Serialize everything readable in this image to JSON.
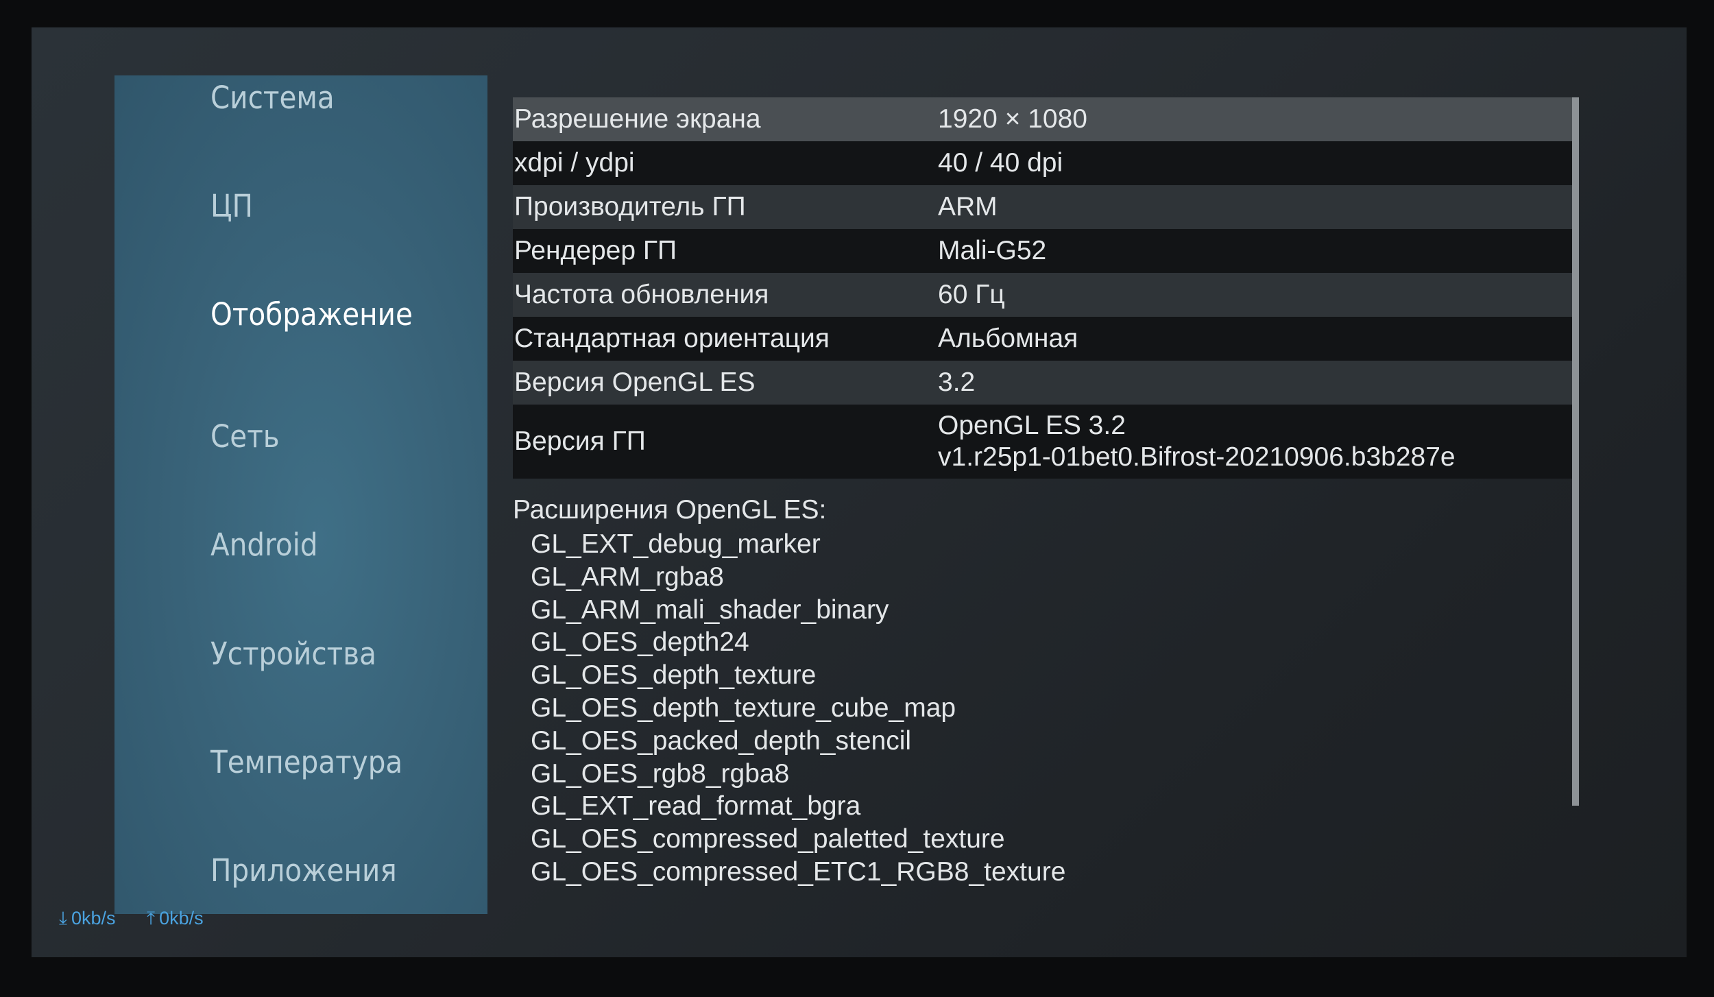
{
  "sidebar": {
    "items": [
      {
        "label": "Система"
      },
      {
        "label": "ЦП"
      },
      {
        "label": "Отображение"
      },
      {
        "label": "Сеть"
      },
      {
        "label": "Android"
      },
      {
        "label": "Устройства"
      },
      {
        "label": "Температура"
      },
      {
        "label": "Приложения"
      }
    ],
    "active_index": 2
  },
  "display_info": {
    "rows": [
      {
        "key": "Разрешение экрана",
        "value": "1920 × 1080"
      },
      {
        "key": "xdpi / ydpi",
        "value": "40 / 40 dpi"
      },
      {
        "key": "Производитель ГП",
        "value": "ARM"
      },
      {
        "key": "Рендерер ГП",
        "value": "Mali-G52"
      },
      {
        "key": "Частота обновления",
        "value": "60 Гц"
      },
      {
        "key": "Стандартная ориентация",
        "value": "Альбомная"
      },
      {
        "key": "Версия OpenGL ES",
        "value": "3.2"
      },
      {
        "key": "Версия ГП",
        "value_line1": "OpenGL ES 3.2",
        "value_line2": "v1.r25p1-01bet0.Bifrost-20210906.b3b287e"
      }
    ]
  },
  "extensions": {
    "title": "Расширения OpenGL ES:",
    "items": [
      "GL_EXT_debug_marker",
      "GL_ARM_rgba8",
      "GL_ARM_mali_shader_binary",
      "GL_OES_depth24",
      "GL_OES_depth_texture",
      "GL_OES_depth_texture_cube_map",
      "GL_OES_packed_depth_stencil",
      "GL_OES_rgb8_rgba8",
      "GL_EXT_read_format_bgra",
      "GL_OES_compressed_paletted_texture",
      "GL_OES_compressed_ETC1_RGB8_texture"
    ]
  },
  "netstats": {
    "download": "0kb/s",
    "upload": "0kb/s"
  },
  "colors": {
    "sidebar_bg": "#396379",
    "accent": "#4aa3e0"
  }
}
